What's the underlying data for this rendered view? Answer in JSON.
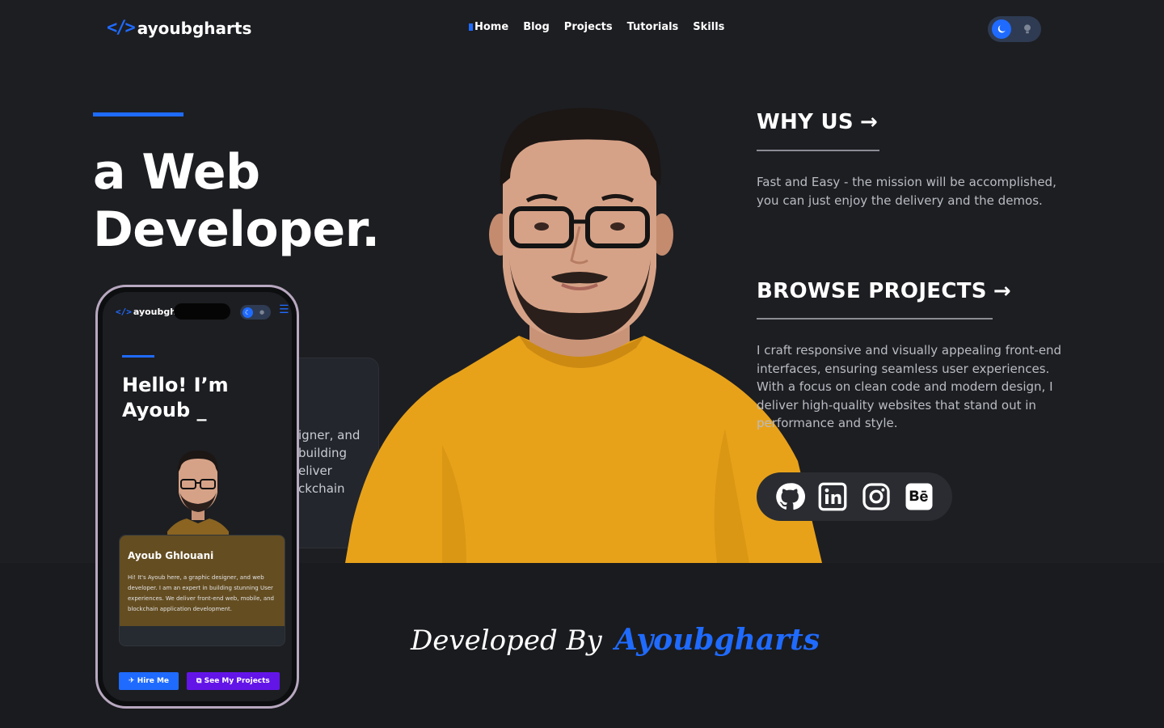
{
  "header": {
    "logo_mark": "</>",
    "logo_text": "ayoubgharts",
    "nav": [
      "Home",
      "Blog",
      "Projects",
      "Tutorials",
      "Skills"
    ],
    "active_nav": "Home",
    "theme_icons": [
      "moon-icon",
      "sun-icon"
    ]
  },
  "hero": {
    "title_line1": "a Web",
    "title_line2": "Developer."
  },
  "ghost_card": {
    "lines": [
      "igner, and",
      "building",
      "eliver",
      "ckchain"
    ]
  },
  "phone": {
    "logo_mark": "</>",
    "logo_text": "ayoubgh",
    "hello_line1": "Hello! I’m",
    "hello_line2": "Ayoub _",
    "card_name": "Ayoub Ghlouani",
    "card_desc": "Hi! It's Ayoub here, a graphic designer, and web developer. I am an expert in building stunning User experiences. We deliver front-end web, mobile, and blockchain application development.",
    "hire_label": "Hire Me",
    "projects_label": "See My Projects"
  },
  "sections": {
    "why_title": "WHY US",
    "why_text": "Fast and Easy - the mission will be accomplished, you can just enjoy the delivery and the demos.",
    "browse_title": "BROWSE PROJECTS",
    "browse_text": "I craft responsive and visually appealing front-end interfaces, ensuring seamless user experiences. With a focus on clean code and modern design, I deliver high-quality websites that stand out in performance and style.",
    "arrow": "→"
  },
  "socials": [
    "github-icon",
    "linkedin-icon",
    "instagram-icon",
    "behance-icon"
  ],
  "footer": {
    "developed_by": "Developed By",
    "author": "Ayoubgharts"
  },
  "colors": {
    "accent": "#1f6bff",
    "purple": "#6315e8",
    "background": "#1d1e22",
    "sweater": "#e8a21a"
  }
}
